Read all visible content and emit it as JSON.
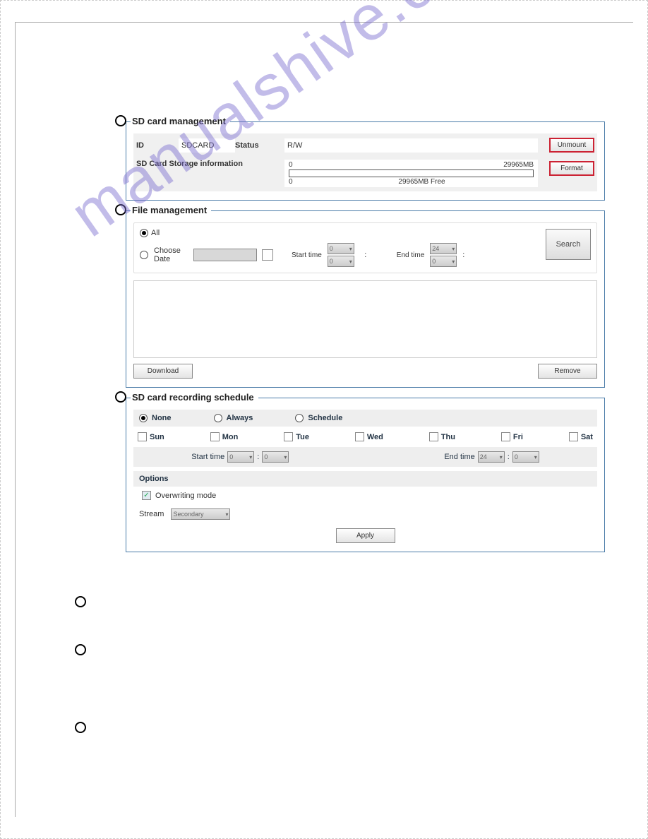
{
  "watermark": "manualshive.com",
  "sd_mgmt": {
    "title": "SD card management",
    "id_label": "ID",
    "id_value": "SDCARD",
    "status_label": "Status",
    "status_value": "R/W",
    "unmount_btn": "Unmount",
    "info_label": "SD Card Storage information",
    "bar_start": "0",
    "bar_end": "29965MB",
    "bar_free_start": "0",
    "bar_free_label": "29965MB Free",
    "format_btn": "Format"
  },
  "file_mgmt": {
    "title": "File management",
    "all_label": "All",
    "choose_date_label": "Choose Date",
    "start_time_label": "Start time",
    "end_time_label": "End time",
    "start_h": "0",
    "start_m": "0",
    "end_h": "24",
    "end_m": "0",
    "search_btn": "Search",
    "download_btn": "Download",
    "remove_btn": "Remove"
  },
  "schedule": {
    "title": "SD card recording schedule",
    "none_label": "None",
    "always_label": "Always",
    "schedule_label": "Schedule",
    "days": {
      "sun": "Sun",
      "mon": "Mon",
      "tue": "Tue",
      "wed": "Wed",
      "thu": "Thu",
      "fri": "Fri",
      "sat": "Sat"
    },
    "start_time_label": "Start time",
    "end_time_label": "End time",
    "start_h": "0",
    "start_m": "0",
    "end_h": "24",
    "end_m": "0",
    "options_label": "Options",
    "overwrite_label": "Overwriting mode",
    "stream_label": "Stream",
    "stream_value": "Secondary",
    "apply_btn": "Apply"
  }
}
